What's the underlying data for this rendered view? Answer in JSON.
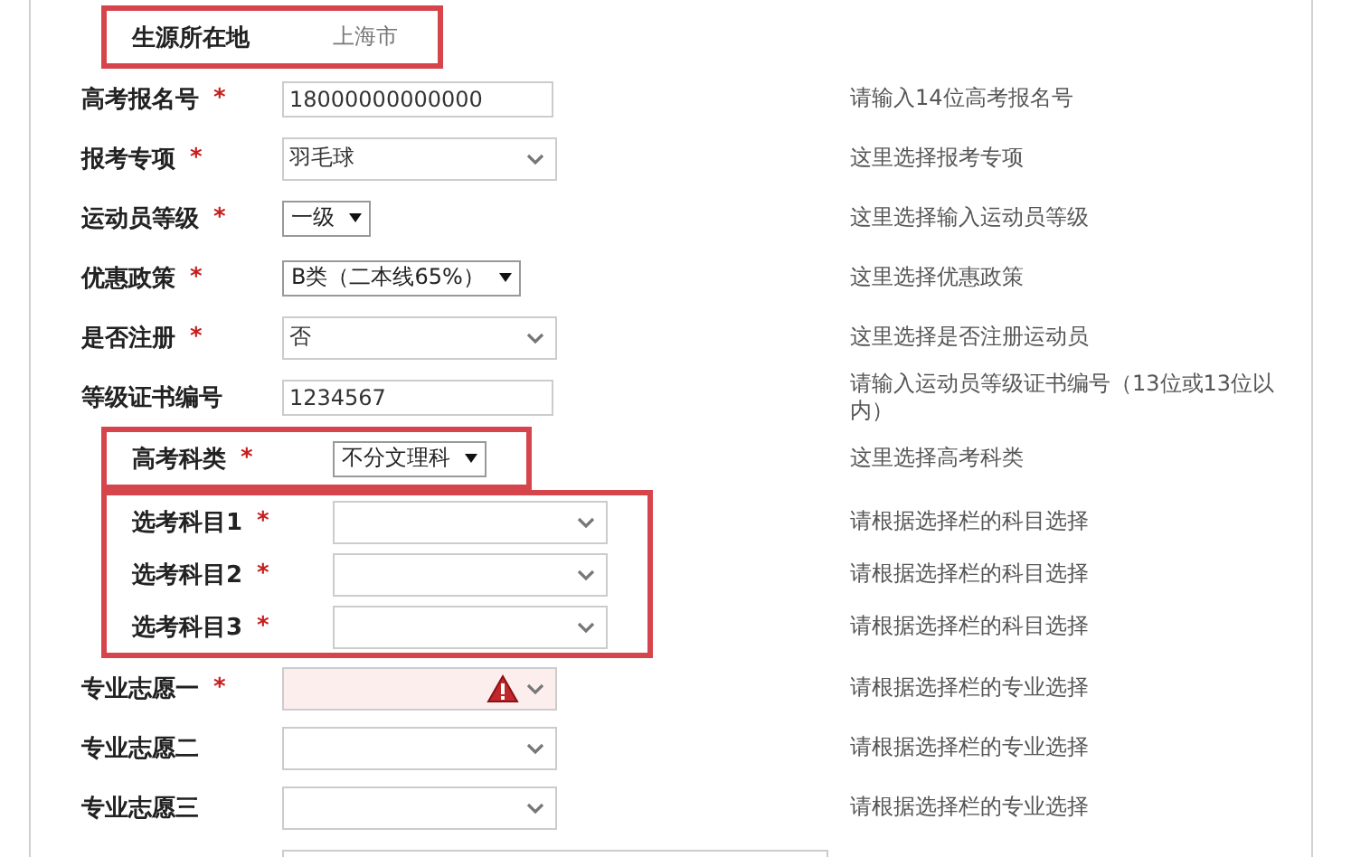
{
  "groups": [
    {
      "highlighted": true,
      "rows": [
        {
          "label": "生源所在地",
          "kind": "static",
          "value": "上海市"
        }
      ]
    },
    {
      "highlighted": false,
      "rows": [
        {
          "label": "高考报名号",
          "mark": "*",
          "kind": "text",
          "value": "18000000000000",
          "hint": "请输入14位高考报名号"
        },
        {
          "label": "报考专项",
          "mark": "*",
          "kind": "select",
          "value": "羽毛球",
          "hint": "这里选择报考专项"
        },
        {
          "label": "运动员等级",
          "mark": "*",
          "kind": "dropdown",
          "value": "一级",
          "hint": "这里选择输入运动员等级"
        },
        {
          "label": "优惠政策",
          "mark": "*",
          "kind": "dropdown",
          "value": "B类（二本线65%）",
          "hint": "这里选择优惠政策"
        },
        {
          "label": "是否注册",
          "mark": "*",
          "kind": "select",
          "value": "否",
          "hint": "这里选择是否注册运动员"
        },
        {
          "label": "等级证书编号",
          "kind": "text",
          "value": "1234567",
          "hint": "请输入运动员等级证书编号（13位或13位以内）"
        }
      ]
    },
    {
      "highlighted": true,
      "rows": [
        {
          "label": "高考科类",
          "mark": "*",
          "kind": "dropdown",
          "value": "不分文理科",
          "hint": "这里选择高考科类"
        }
      ]
    },
    {
      "highlighted": true,
      "rows": [
        {
          "label": "选考科目1",
          "mark": "*",
          "kind": "select",
          "hint": "请根据选择栏的科目选择"
        },
        {
          "label": "选考科目2",
          "mark": "*",
          "kind": "select",
          "hint": "请根据选择栏的科目选择"
        },
        {
          "label": "选考科目3",
          "mark": "*",
          "kind": "select",
          "hint": "请根据选择栏的科目选择"
        }
      ]
    },
    {
      "highlighted": false,
      "rows": [
        {
          "label": "专业志愿一",
          "mark": "*",
          "kind": "select",
          "invalid": true,
          "hint": "请根据选择栏的专业选择"
        },
        {
          "label": "专业志愿二",
          "kind": "select",
          "invalid": false,
          "hint": "请根据选择栏的专业选择"
        },
        {
          "label": "专业志愿三",
          "kind": "select",
          "invalid": false,
          "hint": "请根据选择栏的专业选择"
        },
        {
          "kind": "wide-text"
        }
      ]
    }
  ]
}
